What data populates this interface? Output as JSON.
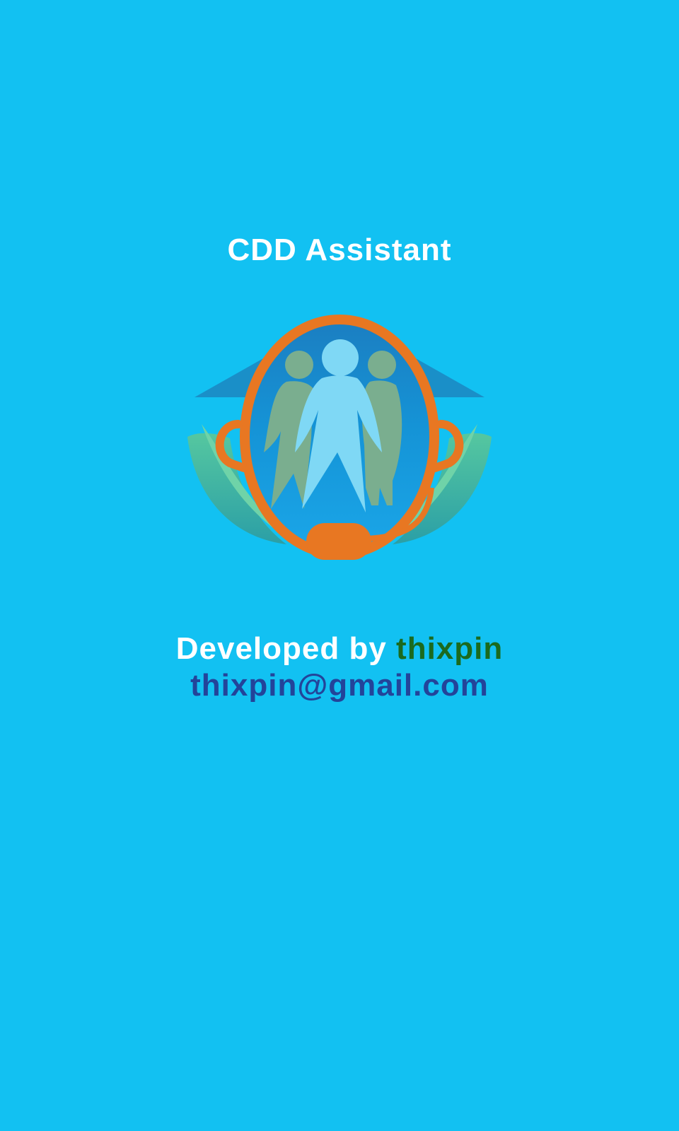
{
  "app": {
    "title": "CDD Assistant"
  },
  "logo": {
    "icon": "community-support-logo-icon",
    "colors": {
      "background": "#12c1f2",
      "headset": "#e87722",
      "roof": "#1a8fc8",
      "leaves": "#4cbb8f",
      "figure_main": "#7fd8f5",
      "figure_side": "#7aae8f"
    }
  },
  "credits": {
    "developed_by_label": "Developed by ",
    "developer_name": "thixpin",
    "email": "thixpin@gmail.com",
    "colors": {
      "label": "#ffffff",
      "developer_name": "#1b6a1e",
      "email": "#23449a"
    }
  }
}
